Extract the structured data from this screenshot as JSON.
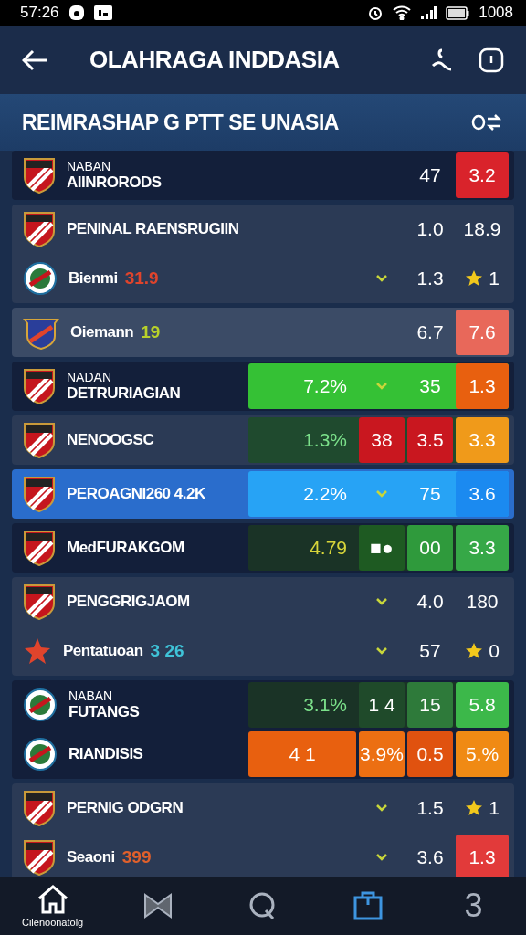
{
  "status_bar": {
    "time": "57:26",
    "battery": "1008"
  },
  "app_bar": {
    "title": "OLAHRAGA INDDASIA"
  },
  "section": {
    "title": "REIMRASHAP G PTT SE UNASIA"
  },
  "groups": [
    {
      "kind": "dark",
      "rows": [
        {
          "kind": "shield",
          "sub": "NABAN",
          "name": "AIINRORODS",
          "selected": false,
          "cells": [
            "",
            "",
            {
              "kind": "text",
              "text": "47"
            },
            {
              "kind": "box",
              "text": "3.2",
              "color": "#d9232b"
            }
          ]
        }
      ]
    },
    {
      "kind": "grey",
      "rows": [
        {
          "kind": "shield",
          "name": "PENINAL RAENSRUGIIN",
          "selected": false,
          "cells": [
            "",
            "",
            {
              "kind": "text",
              "text": "1.0"
            },
            {
              "kind": "text",
              "text": "18.9"
            }
          ]
        },
        {
          "kind": "round",
          "name": "Bienmi",
          "tag": {
            "text": "31.9",
            "color": "#e0442c"
          },
          "selected": false,
          "cells": [
            "",
            {
              "kind": "arrow"
            },
            {
              "kind": "text",
              "text": "1.3"
            },
            {
              "kind": "star",
              "text": "1"
            }
          ]
        }
      ]
    },
    {
      "kind": "light",
      "rows": [
        {
          "kind": "banner",
          "name": "Oiemann",
          "tag": {
            "text": "19",
            "color": "#b8d12a"
          },
          "selected": false,
          "cells": [
            "",
            "",
            {
              "kind": "text",
              "text": "6.7"
            },
            {
              "kind": "box",
              "text": "7.6",
              "color": "#e8685a"
            }
          ]
        }
      ]
    },
    {
      "kind": "dark",
      "rows": [
        {
          "kind": "shield",
          "sub": "NADAN",
          "name": "DETRURIAGIAN",
          "selected": false,
          "color": "#35c135",
          "cells": [
            {
              "kind": "text",
              "text": "7.2%"
            },
            {
              "kind": "arrow"
            },
            {
              "kind": "text",
              "text": "35"
            },
            {
              "kind": "box",
              "text": "1.3",
              "color": "#e8600f"
            }
          ]
        }
      ]
    },
    {
      "kind": "grey",
      "rows": [
        {
          "kind": "shield",
          "name": "NENOOGSC",
          "selected": false,
          "color": "#1f4a2e",
          "cells": [
            {
              "kind": "text",
              "text": "1.3%",
              "color": "#7be08a"
            },
            {
              "kind": "box",
              "text": "38",
              "color": "#c9171f"
            },
            {
              "kind": "box",
              "text": "3.5",
              "color": "#c9171f"
            },
            {
              "kind": "box",
              "text": "3.3",
              "color": "#f09a1a"
            }
          ]
        }
      ]
    },
    {
      "kind": "grey",
      "rows": [
        {
          "kind": "shield",
          "name": "PEROAGNI260 4.2K",
          "selected": true,
          "color": "#27a3f5",
          "cells": [
            {
              "kind": "text",
              "text": "2.2%"
            },
            {
              "kind": "arrow"
            },
            {
              "kind": "text",
              "text": "75"
            },
            {
              "kind": "box",
              "text": "3.6",
              "color": "#1b8af0"
            }
          ]
        }
      ]
    },
    {
      "kind": "dark",
      "rows": [
        {
          "kind": "shield",
          "name": "MedFURAKGOM",
          "selected": false,
          "color": "#1a3326",
          "cells": [
            {
              "kind": "text",
              "text": "4.79",
              "color": "#d8d63a"
            },
            {
              "kind": "box",
              "text": "■●",
              "color": "#1e5a22"
            },
            {
              "kind": "box",
              "text": "00",
              "color": "#2f9a3c"
            },
            {
              "kind": "box",
              "text": "3.3",
              "color": "#36a847"
            }
          ]
        }
      ]
    },
    {
      "kind": "grey",
      "rows": [
        {
          "kind": "shield",
          "name": "PENGGRIGJAOM",
          "selected": false,
          "cells": [
            "",
            {
              "kind": "arrow"
            },
            {
              "kind": "text",
              "text": "4.0"
            },
            {
              "kind": "text",
              "text": "180"
            }
          ]
        },
        {
          "kind": "star",
          "name": "Pentatuoan",
          "tag": {
            "text": "3 26",
            "color": "#3fc3d8"
          },
          "selected": false,
          "cells": [
            "",
            {
              "kind": "arrow"
            },
            {
              "kind": "text",
              "text": "57"
            },
            {
              "kind": "star",
              "text": "0"
            }
          ]
        }
      ]
    },
    {
      "kind": "dark",
      "rows": [
        {
          "kind": "round",
          "sub": "NABAN",
          "name": "FUTANGS",
          "selected": false,
          "color": "#1a3326",
          "cells": [
            {
              "kind": "text",
              "text": "3.1%",
              "color": "#7be08a"
            },
            {
              "kind": "box",
              "text": "1 4",
              "color": "#1f4a2a"
            },
            {
              "kind": "box",
              "text": "15",
              "color": "#2e7a3a"
            },
            {
              "kind": "box",
              "text": "5.8",
              "color": "#3cb84a"
            }
          ]
        },
        {
          "kind": "round",
          "name": "RIANDISIS",
          "selected": false,
          "cells": [
            {
              "kind": "box",
              "text": "4 1",
              "color": "#e8600f"
            },
            {
              "kind": "box",
              "text": "3.9%",
              "color": "#ec6f12"
            },
            {
              "kind": "box",
              "text": "0.5",
              "color": "#e0520f"
            },
            {
              "kind": "box",
              "text": "5.%",
              "color": "#f08a14"
            }
          ]
        }
      ]
    },
    {
      "kind": "grey",
      "rows": [
        {
          "kind": "shield",
          "name": "PERNIG ODGRN",
          "selected": false,
          "cells": [
            "",
            {
              "kind": "arrow"
            },
            {
              "kind": "text",
              "text": "1.5"
            },
            {
              "kind": "star",
              "text": "1"
            }
          ]
        },
        {
          "kind": "shield",
          "name": "Seaoni",
          "tag": {
            "text": "399",
            "color": "#e0602c"
          },
          "selected": false,
          "cells": [
            "",
            {
              "kind": "arrow"
            },
            {
              "kind": "text",
              "text": "3.6"
            },
            {
              "kind": "box",
              "text": "1.3",
              "color": "#e23a3a"
            }
          ]
        }
      ]
    }
  ],
  "nav": [
    {
      "kind": "home",
      "label": "Cilenoonatolg",
      "selected": false
    },
    {
      "kind": "bowtie",
      "selected": false
    },
    {
      "kind": "search",
      "selected": false
    },
    {
      "kind": "bag",
      "selected": true
    },
    {
      "kind": "glyph",
      "text": "3",
      "selected": false
    }
  ]
}
